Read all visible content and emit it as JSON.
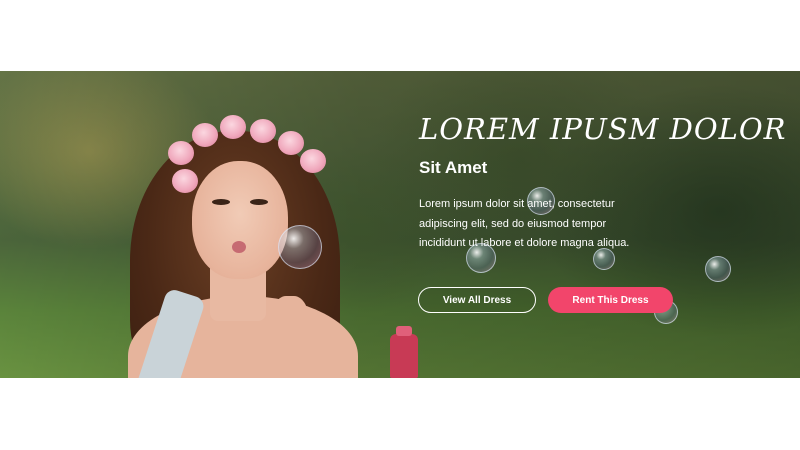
{
  "hero": {
    "title": "LOREM IPUSM DOLOR",
    "subtitle": "Sit Amet",
    "description": "Lorem ipsum dolor sit amet, consectetur adipiscing elit, sed do eiusmod tempor incididunt ut labore et dolore magna aliqua.",
    "buttons": {
      "view_all": "View All Dress",
      "rent": "Rent This Dress"
    },
    "colors": {
      "accent": "#f2456b",
      "text": "#ffffff"
    }
  }
}
